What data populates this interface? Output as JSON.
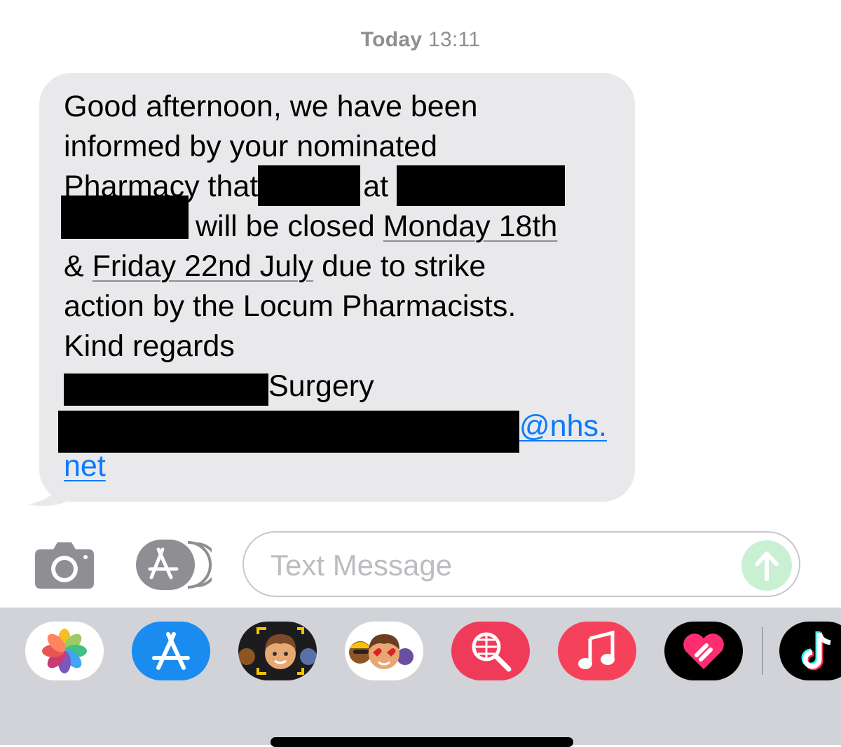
{
  "timestamp": {
    "day": "Today",
    "time": "13:11"
  },
  "message": {
    "line1": "Good afternoon, we have been",
    "line2": "informed by your nominated",
    "line3_a": "Pharmacy that",
    "line3_b": "at",
    "line4_a": "will be closed",
    "line4_date": "Monday 18th",
    "line5_a": "&",
    "line5_date": "Friday 22nd July",
    "line5_b": "due to strike",
    "line6": "action by the Locum Pharmacists.",
    "line7": "Kind regards",
    "line8": "Surgery",
    "email_part1": "@nhs.",
    "email_part2": "net"
  },
  "input_bar": {
    "placeholder": "Text Message",
    "icons": {
      "camera": "camera-icon",
      "apps": "app-store-icon",
      "send": "arrow-up-icon"
    }
  },
  "app_drawer": {
    "apps": [
      {
        "name": "photos",
        "icon": "photos-icon"
      },
      {
        "name": "app-store",
        "icon": "app-store-icon"
      },
      {
        "name": "memoji-stickers",
        "icon": "memoji-icon"
      },
      {
        "name": "animoji",
        "icon": "animoji-icon"
      },
      {
        "name": "image-search",
        "icon": "globe-search-icon"
      },
      {
        "name": "music",
        "icon": "music-note-icon"
      },
      {
        "name": "digital-touch",
        "icon": "heart-icon"
      },
      {
        "name": "tiktok",
        "icon": "tiktok-icon"
      }
    ]
  },
  "colors": {
    "bubble": "#e9e9eb",
    "link": "#0a7aff",
    "tray": "#d2d3d8",
    "send": "#c9f0d3"
  }
}
